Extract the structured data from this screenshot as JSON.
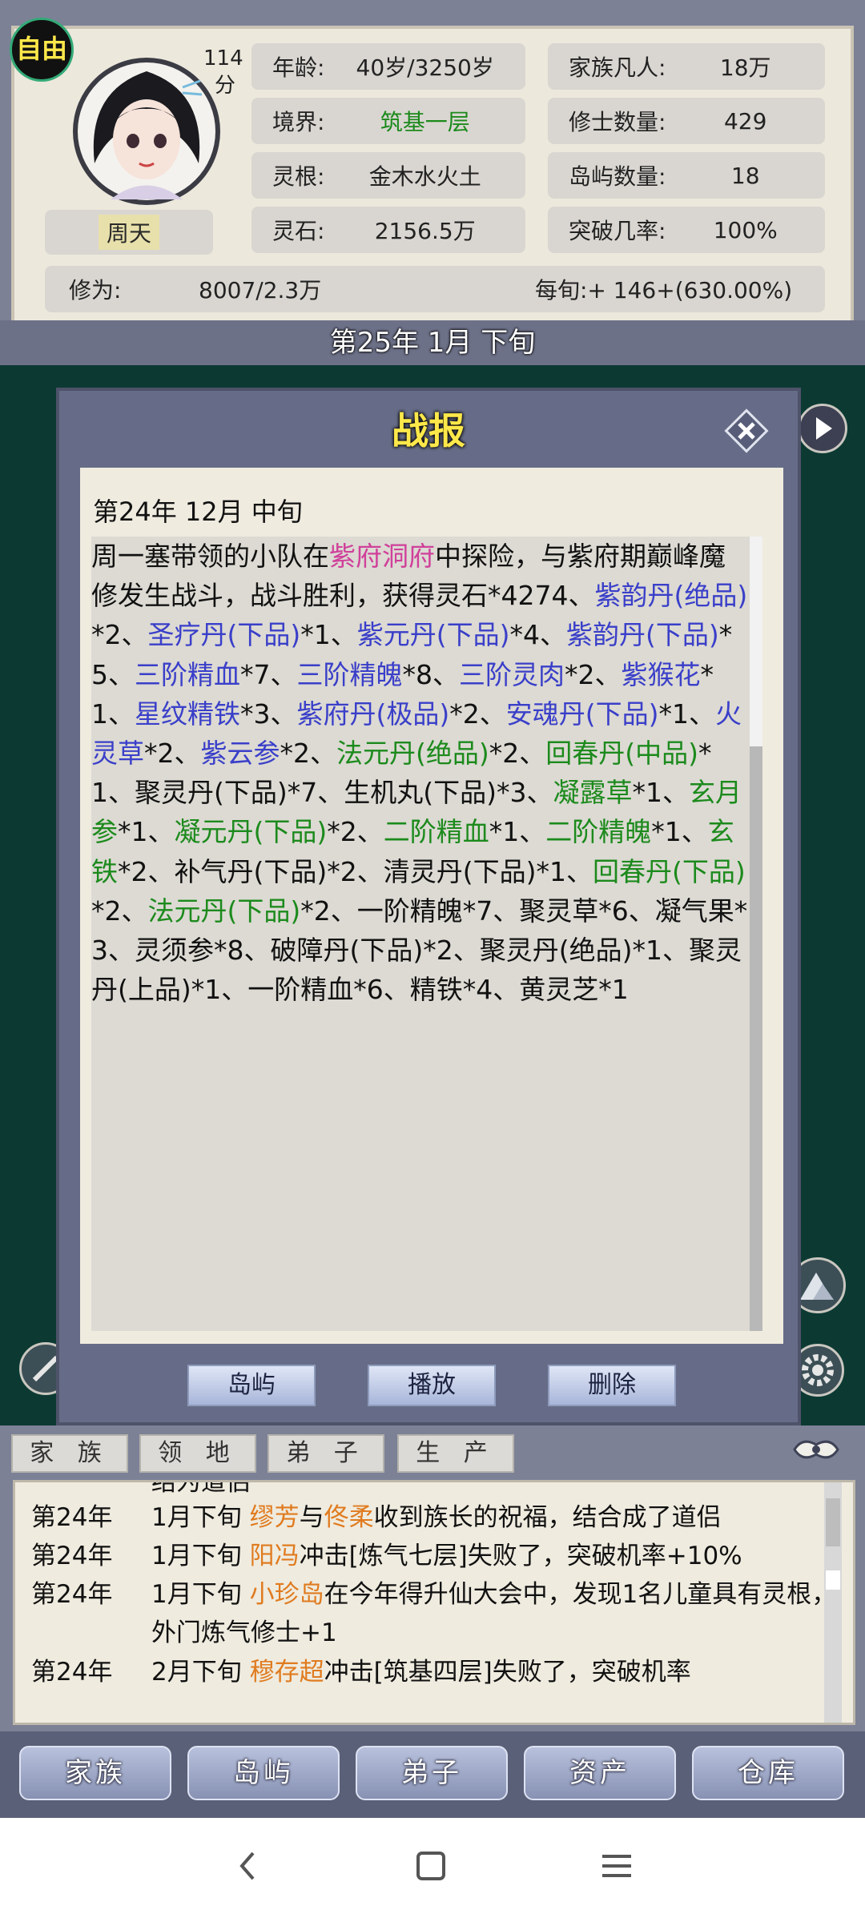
{
  "header": {
    "mode_badge": "自由",
    "count_number": "114",
    "count_unit": "分",
    "character_name": "周天",
    "stats": {
      "age_label": "年龄:",
      "age_value": "40岁/3250岁",
      "realm_label": "境界:",
      "realm_value": "筑基一层",
      "root_label": "灵根:",
      "root_value": "金木水火土",
      "stone_label": "灵石:",
      "stone_value": "2156.5万",
      "mortals_label": "家族凡人:",
      "mortals_value": "18万",
      "cultivators_label": "修士数量:",
      "cultivators_value": "429",
      "islands_label": "岛屿数量:",
      "islands_value": "18",
      "breakthrough_label": "突破几率:",
      "breakthrough_value": "100%",
      "cultivation_label": "修为:",
      "cultivation_value": "8007/2.3万",
      "per_period": "每旬:+ 146+(630.00%)"
    },
    "current_date": "第25年 1月 下旬",
    "colors": {
      "realm_value": "#1c8a1c",
      "name_text": "#2a2a2a",
      "name_bg": "#e8e0ab"
    }
  },
  "modal": {
    "title": "战报",
    "report_date": "第24年 12月 中旬",
    "report_segments": [
      {
        "t": "周一塞带领的小队在",
        "c": ""
      },
      {
        "t": "紫府洞府",
        "c": "p"
      },
      {
        "t": "中探险，与紫府期巅峰魔修发生战斗，战斗胜利，获得灵石*4274、",
        "c": ""
      },
      {
        "t": "紫韵丹(绝品)",
        "c": "b"
      },
      {
        "t": "*2、",
        "c": ""
      },
      {
        "t": "圣疗丹(下品)",
        "c": "b"
      },
      {
        "t": "*1、",
        "c": ""
      },
      {
        "t": "紫元丹(下品)",
        "c": "b"
      },
      {
        "t": "*4、",
        "c": ""
      },
      {
        "t": "紫韵丹(下品)",
        "c": "b"
      },
      {
        "t": "*5、",
        "c": ""
      },
      {
        "t": "三阶精血",
        "c": "b"
      },
      {
        "t": "*7、",
        "c": ""
      },
      {
        "t": "三阶精魄",
        "c": "b"
      },
      {
        "t": "*8、",
        "c": ""
      },
      {
        "t": "三阶灵肉",
        "c": "b"
      },
      {
        "t": "*2、",
        "c": ""
      },
      {
        "t": "紫猴花",
        "c": "b"
      },
      {
        "t": "*1、",
        "c": ""
      },
      {
        "t": "星纹精铁",
        "c": "b"
      },
      {
        "t": "*3、",
        "c": ""
      },
      {
        "t": "紫府丹(极品)",
        "c": "b"
      },
      {
        "t": "*2、",
        "c": ""
      },
      {
        "t": "安魂丹(下品)",
        "c": "b"
      },
      {
        "t": "*1、",
        "c": ""
      },
      {
        "t": "火灵草",
        "c": "b"
      },
      {
        "t": "*2、",
        "c": ""
      },
      {
        "t": "紫云参",
        "c": "b"
      },
      {
        "t": "*2、",
        "c": ""
      },
      {
        "t": "法元丹(绝品)",
        "c": "g"
      },
      {
        "t": "*2、",
        "c": ""
      },
      {
        "t": "回春丹(中品)",
        "c": "g"
      },
      {
        "t": "*1、聚灵丹(下品)*7、生机丸(下品)*3、",
        "c": ""
      },
      {
        "t": "凝露草",
        "c": "g"
      },
      {
        "t": "*1、",
        "c": ""
      },
      {
        "t": "玄月参",
        "c": "g"
      },
      {
        "t": "*1、",
        "c": ""
      },
      {
        "t": "凝元丹(下品)",
        "c": "g"
      },
      {
        "t": "*2、",
        "c": ""
      },
      {
        "t": "二阶精血",
        "c": "g"
      },
      {
        "t": "*1、",
        "c": ""
      },
      {
        "t": "二阶精魄",
        "c": "g"
      },
      {
        "t": "*1、",
        "c": ""
      },
      {
        "t": "玄铁",
        "c": "g"
      },
      {
        "t": "*2、补气丹(下品)*2、清灵丹(下品)*1、",
        "c": ""
      },
      {
        "t": "回春丹(下品)",
        "c": "g"
      },
      {
        "t": "*2、",
        "c": ""
      },
      {
        "t": "法元丹(下品)",
        "c": "g"
      },
      {
        "t": "*2、一阶精魄*7、聚灵草*6、凝气果*3、灵须参*8、破障丹(下品)*2、聚灵丹(绝品)*1、聚灵丹(上品)*1、一阶精血*6、精铁*4、黄灵芝*1",
        "c": ""
      }
    ],
    "buttons": {
      "islands": "岛屿",
      "play": "播放",
      "delete": "删除"
    },
    "colors": {
      "place": "#d0409a",
      "blue_item": "#3a3fc9",
      "green_item": "#1c8a1c",
      "title": "#ffe84a"
    }
  },
  "tabs": [
    "家 族",
    "领 地",
    "弟 子",
    "生 产"
  ],
  "log": {
    "cut_top": "结为道侣",
    "rows": [
      {
        "year": "第24年",
        "pre": "1月下旬 ",
        "n1": "缪芳",
        "mid": "与",
        "n2": "佟柔",
        "post": "收到族长的祝福，结合成了道侣"
      },
      {
        "year": "第24年",
        "pre": "1月下旬 ",
        "n1": "阳冯",
        "mid": "",
        "n2": "",
        "post": "冲击[炼气七层]失败了，突破机率+10%"
      },
      {
        "year": "第24年",
        "pre": "1月下旬 ",
        "n1": "小珍岛",
        "mid": "",
        "n2": "",
        "post": "在今年得升仙大会中，发现1名儿童具有灵根，外门炼气修士+1"
      },
      {
        "year": "第24年",
        "pre": "2月下旬 ",
        "n1": "穆存超",
        "mid": "",
        "n2": "",
        "post": "冲击[筑基四层]失败了，突破机率"
      }
    ]
  },
  "nav": [
    "家族",
    "岛屿",
    "弟子",
    "资产",
    "仓库"
  ],
  "system_bar": {
    "back": "‹",
    "home": "▢",
    "menu": "☰"
  }
}
